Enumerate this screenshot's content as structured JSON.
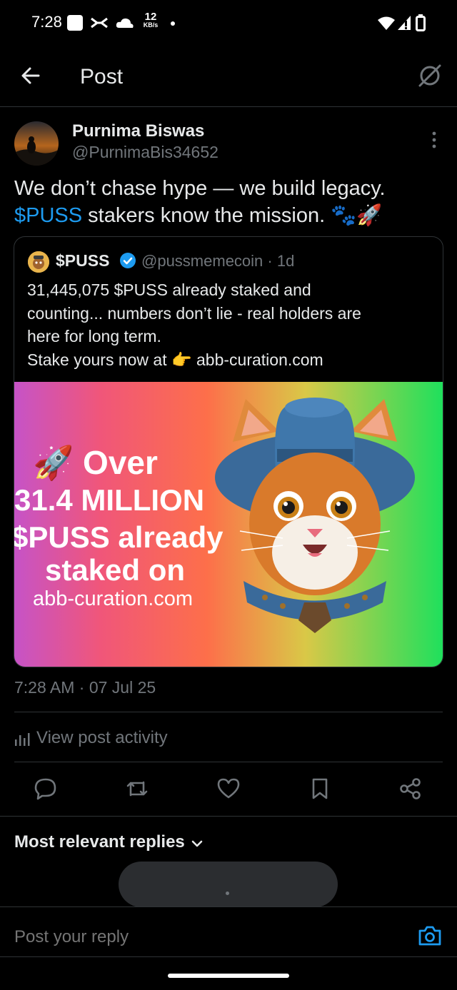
{
  "status_bar": {
    "time": "7:28",
    "net_speed_value": "12",
    "net_speed_unit": "KB/s",
    "icons": [
      "square-icon",
      "link-icon",
      "cloud-icon",
      "dot-icon",
      "wifi-icon",
      "signal-icon",
      "battery-icon"
    ]
  },
  "header": {
    "title": "Post",
    "back_icon": "arrow-left-icon",
    "grok_icon": "grok-icon"
  },
  "post": {
    "author_name": "Purnima Biswas",
    "author_handle": "@PurnimaBis34652",
    "text_line1": "We don’t chase hype — we build legacy.",
    "cashtag": "$PUSS",
    "text_line2_rest": " stakers know the mission. 🐾🚀",
    "timestamp": "7:28 AM · 07 Jul 25"
  },
  "quote": {
    "name": "$PUSS",
    "handle_time": "@pussmemecoin · 1d",
    "text": "31,445,075 $PUSS already staked and\ncounting... numbers don’t lie - real holders are\nhere for long term.\nStake yours now at 👉 abb-curation.com",
    "image": {
      "line1": "🚀 Over",
      "line2": "31.4 MILLION",
      "line3": "$PUSS already",
      "line4": "staked on",
      "line5": "abb-curation.com"
    }
  },
  "activity": {
    "label": "View post activity"
  },
  "actions": [
    {
      "name": "reply",
      "icon": "reply-icon"
    },
    {
      "name": "repost",
      "icon": "repost-icon"
    },
    {
      "name": "like",
      "icon": "heart-icon"
    },
    {
      "name": "bookmark",
      "icon": "bookmark-icon"
    },
    {
      "name": "share",
      "icon": "share-icon"
    }
  ],
  "replies": {
    "sort_label": "Most relevant replies"
  },
  "composer": {
    "placeholder": "Post your reply"
  },
  "colors": {
    "background": "#000000",
    "text": "#e7e9ea",
    "muted": "#71767b",
    "accent": "#1d9bf0",
    "border": "#2f3336"
  }
}
